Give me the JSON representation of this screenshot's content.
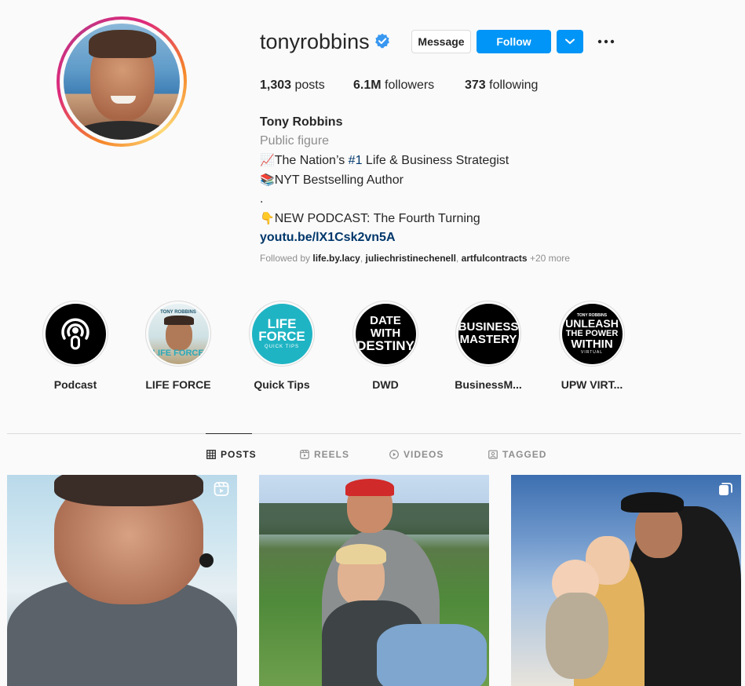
{
  "profile": {
    "username": "tonyrobbins",
    "verified": true,
    "buttons": {
      "message": "Message",
      "follow": "Follow"
    },
    "stats": {
      "posts_count": "1,303",
      "posts_label": "posts",
      "followers_count": "6.1M",
      "followers_label": "followers",
      "following_count": "373",
      "following_label": "following"
    },
    "bio": {
      "name": "Tony Robbins",
      "category": "Public figure",
      "line1_emoji": "📈",
      "line1_text_a": "The Nation’s ",
      "line1_hashtag": "#1",
      "line1_text_b": " Life & Business Strategist",
      "line2_emoji": "📚",
      "line2_text": "NYT Bestselling Author",
      "line3": ".",
      "line4_emoji": "👇",
      "line4_text": "NEW PODCAST: The Fourth Turning",
      "link": "youtu.be/lX1Csk2vn5A"
    },
    "followed_by": {
      "prefix": "Followed by ",
      "users": [
        "life.by.lacy",
        "juliechristinechenell",
        "artfulcontracts"
      ],
      "sep": ", ",
      "more": " +20 more"
    }
  },
  "highlights": [
    {
      "label": "Podcast",
      "icon": "podcast-icon"
    },
    {
      "label": "LIFE FORCE",
      "cover_title": "TONY ROBBINS",
      "cover_text": "LIFE FORCE"
    },
    {
      "label": "Quick Tips",
      "cover_line1": "LIFE FORCE",
      "cover_line2": "QUICK TIPS"
    },
    {
      "label": "DWD",
      "cover_line1": "DATE WITH",
      "cover_line2": "DESTINY"
    },
    {
      "label": "BusinessM...",
      "cover_line1": "BUSINESS",
      "cover_line2": "MASTERY"
    },
    {
      "label": "UPW VIRT...",
      "cover_top": "TONY ROBBINS",
      "cover_line1": "UNLEASH",
      "cover_line2": "THE POWER",
      "cover_line3": "WITHIN",
      "cover_bottom": "VIRTUAL"
    }
  ],
  "tabs": [
    {
      "label": "POSTS",
      "icon": "grid-icon",
      "active": true
    },
    {
      "label": "REELS",
      "icon": "reels-icon",
      "active": false
    },
    {
      "label": "VIDEOS",
      "icon": "play-icon",
      "active": false
    },
    {
      "label": "TAGGED",
      "icon": "tag-icon",
      "active": false
    }
  ],
  "posts": [
    {
      "type": "reel",
      "badge_icon": "reel-badge-icon"
    },
    {
      "type": "image",
      "badge_icon": ""
    },
    {
      "type": "carousel",
      "badge_icon": "carousel-badge-icon"
    }
  ],
  "colors": {
    "accent": "#0095f6",
    "link": "#00376b",
    "muted": "#8e8e8e",
    "text": "#262626"
  }
}
